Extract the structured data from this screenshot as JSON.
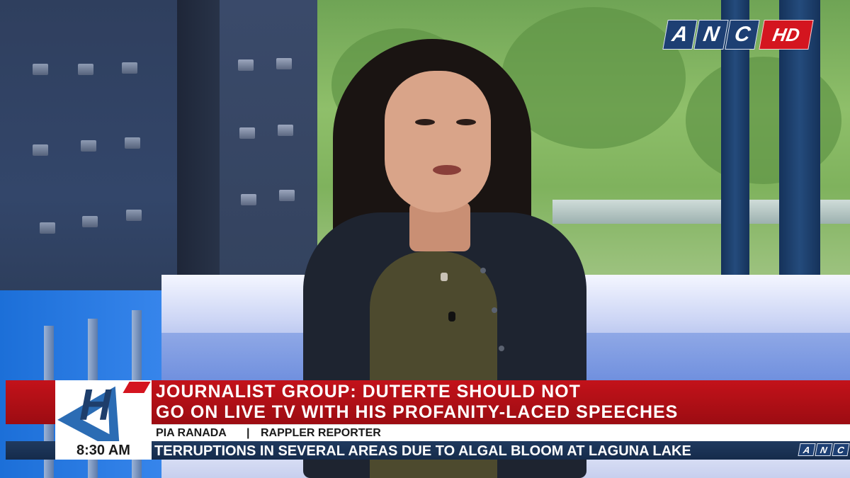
{
  "channel_logo": {
    "letters": [
      "A",
      "N",
      "C"
    ],
    "hd": "HD"
  },
  "show_logo": {
    "letter": "H"
  },
  "lower_third": {
    "headline_line1": "JOURNALIST GROUP: DUTERTE SHOULD NOT",
    "headline_line2": "GO ON LIVE TV WITH HIS PROFANITY-LACED SPEECHES",
    "guest_name": "PIA RANADA",
    "separator": "|",
    "guest_title": "RAPPLER REPORTER",
    "time": "8:30 AM",
    "ticker": "TERRUPTIONS IN SEVERAL AREAS DUE TO ALGAL BLOOM AT LAGUNA LAKE",
    "ticker_logo": [
      "A",
      "N",
      "C"
    ]
  },
  "colors": {
    "brand_red": "#c3121a",
    "brand_blue": "#1d3f73",
    "ticker_bg": "#203a5f"
  }
}
